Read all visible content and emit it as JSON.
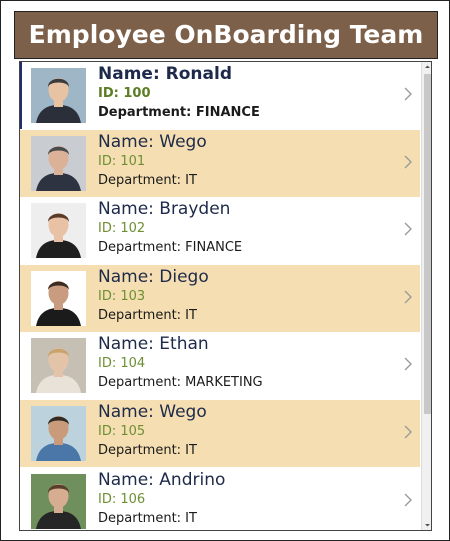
{
  "header": {
    "title": "Employee OnBoarding Team"
  },
  "employees": [
    {
      "name": "Name: Ronald",
      "id": "ID: 100",
      "department": "Department: FINANCE",
      "selected": true,
      "striped": false,
      "bg": "#9fb6c6",
      "skin": "#e7c3a4",
      "hair": "#3b3b3b",
      "shirt": "#2b2f3a"
    },
    {
      "name": "Name: Wego",
      "id": "ID: 101",
      "department": "Department: IT",
      "selected": false,
      "striped": true,
      "bg": "#c9ccd1",
      "skin": "#dbb297",
      "hair": "#4a4a4a",
      "shirt": "#2d3340"
    },
    {
      "name": "Name: Brayden",
      "id": "ID: 102",
      "department": "Department: FINANCE",
      "selected": false,
      "striped": false,
      "bg": "#eeeeee",
      "skin": "#e9c2a6",
      "hair": "#5a3a28",
      "shirt": "#1f1f1f"
    },
    {
      "name": "Name: Diego",
      "id": "ID: 103",
      "department": "Department: IT",
      "selected": false,
      "striped": true,
      "bg": "#ffffff",
      "skin": "#c99c7f",
      "hair": "#3a2a20",
      "shirt": "#1b1b1b"
    },
    {
      "name": "Name: Ethan",
      "id": "ID: 104",
      "department": "Department: MARKETING",
      "selected": false,
      "striped": false,
      "bg": "#c6c0b4",
      "skin": "#e4c4a8",
      "hair": "#c9a36a",
      "shirt": "#e8e2d8"
    },
    {
      "name": "Name: Wego",
      "id": "ID: 105",
      "department": "Department: IT",
      "selected": false,
      "striped": true,
      "bg": "#bcd2dc",
      "skin": "#c99b7a",
      "hair": "#2f2a24",
      "shirt": "#4a77a8"
    },
    {
      "name": "Name: Andrino",
      "id": "ID: 106",
      "department": "Department: IT",
      "selected": false,
      "striped": false,
      "bg": "#6f8f5d",
      "skin": "#d7ad92",
      "hair": "#5a3d2b",
      "shirt": "#262626"
    }
  ],
  "colors": {
    "header_bg": "#7d6049",
    "stripe": "#f5dfb2",
    "id_green": "#6d8f32",
    "name_navy": "#1e2a4a"
  },
  "icons": {
    "row_action": "chevron-right-icon",
    "scroll_up": "scroll-up-arrow-icon",
    "scroll_down": "scroll-down-arrow-icon"
  }
}
